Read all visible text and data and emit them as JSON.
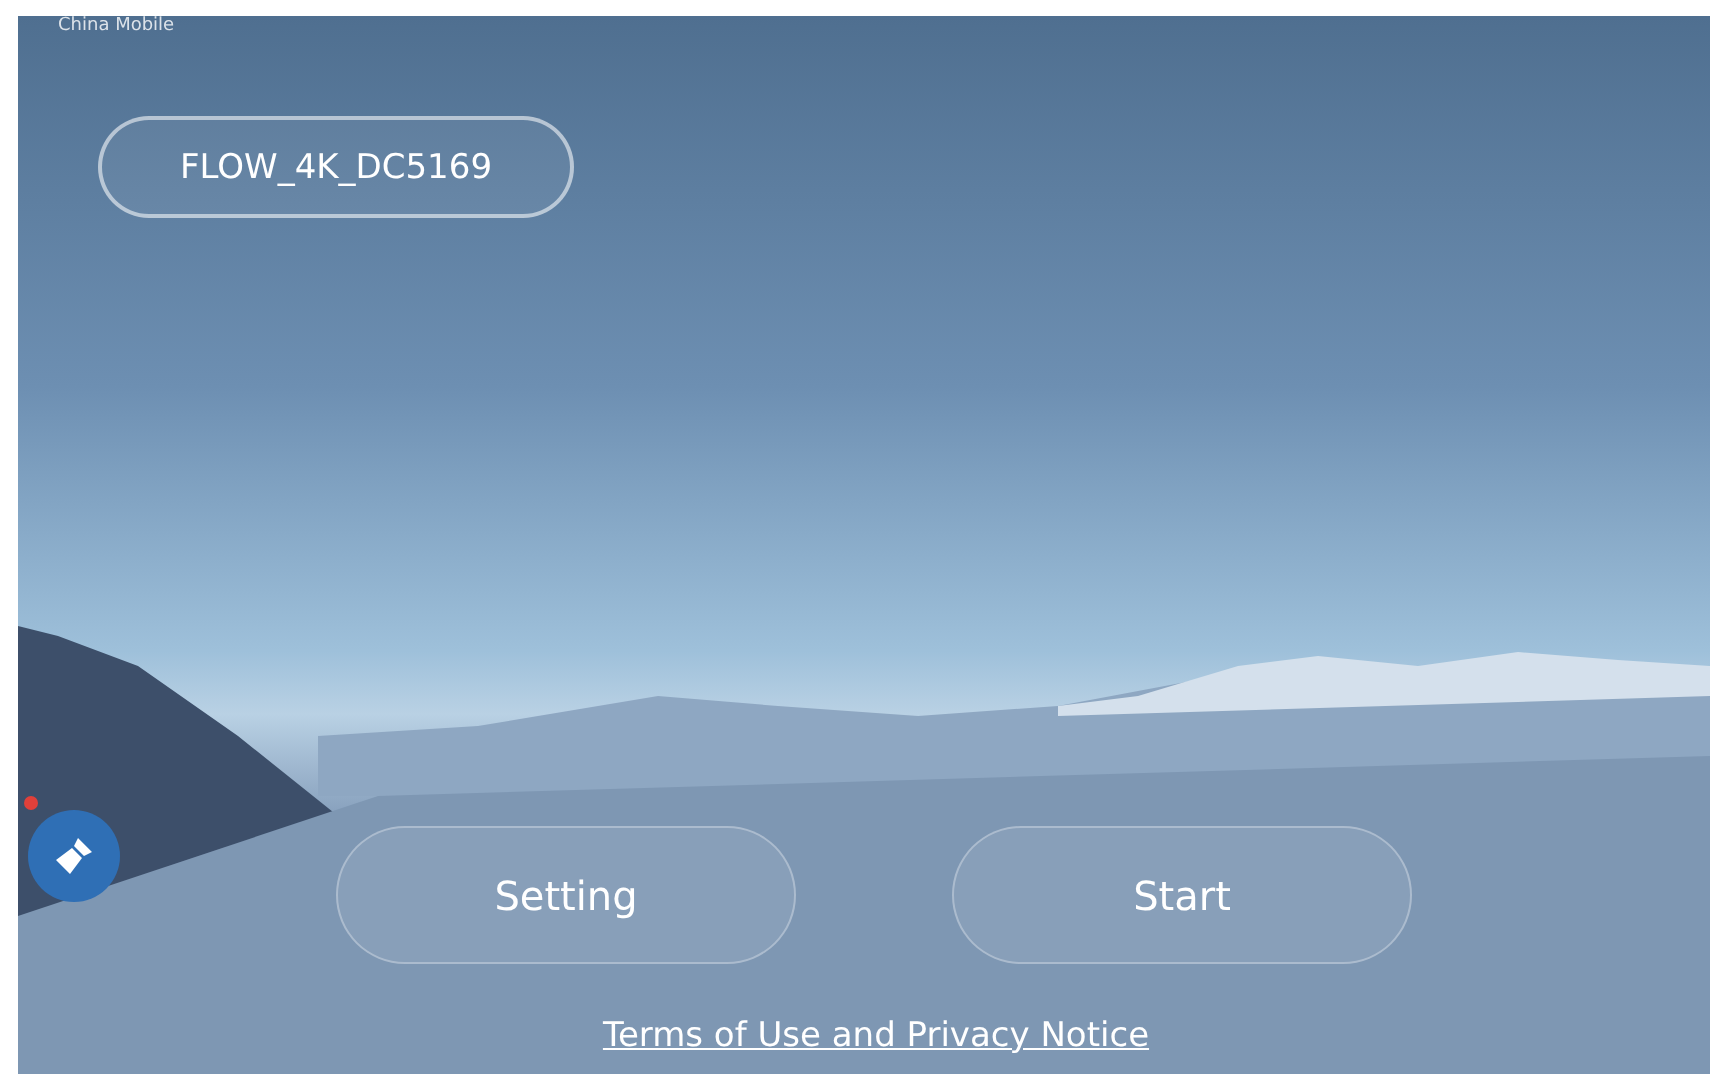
{
  "status_bar": {
    "carrier": "China Mobile"
  },
  "device": {
    "name": "FLOW_4K_DC5169"
  },
  "floating_button": {
    "notification": true
  },
  "buttons": [
    {
      "label": "Setting"
    },
    {
      "label": "Start"
    }
  ],
  "footer": {
    "link": "Terms of Use and Privacy Notice"
  }
}
